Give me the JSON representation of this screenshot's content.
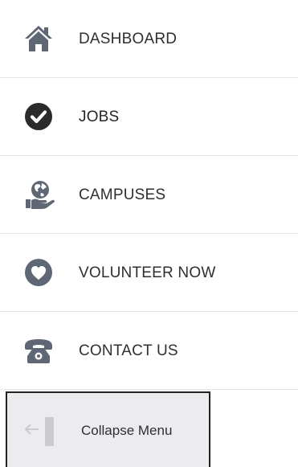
{
  "sidebar": {
    "items": [
      {
        "id": "dashboard",
        "label": "DASHBOARD",
        "icon": "home-icon"
      },
      {
        "id": "jobs",
        "label": "JOBS",
        "icon": "check-circle-icon"
      },
      {
        "id": "campuses",
        "label": "CAMPUSES",
        "icon": "globe-in-hand-icon"
      },
      {
        "id": "volunteer",
        "label": "VOLUNTEER NOW",
        "icon": "heart-circle-icon"
      },
      {
        "id": "contact",
        "label": "CONTACT US",
        "icon": "telephone-icon"
      }
    ],
    "collapse": {
      "label": "Collapse Menu",
      "icon": "collapse-arrow-icon"
    }
  },
  "colors": {
    "icon_gray": "#5f6775",
    "icon_dark": "#2b2b2b",
    "text": "#2f2f33",
    "divider": "#e6e6e6",
    "collapse_bg": "#ececee"
  }
}
